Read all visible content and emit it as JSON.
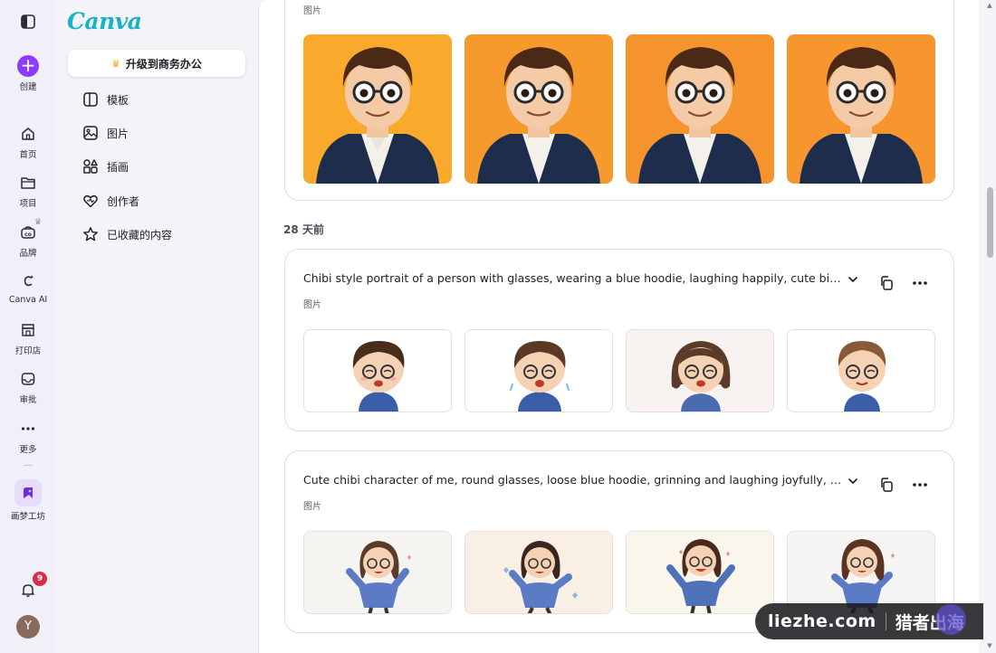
{
  "rail": {
    "create": "创建",
    "home": "首页",
    "projects": "项目",
    "brand": "品牌",
    "canva_ai": "Canva AI",
    "print_shop": "打印店",
    "approvals": "审批",
    "more": "更多",
    "dream_lab": "画梦工坊",
    "notification_count": "9",
    "avatar_initial": "Y"
  },
  "sidebar": {
    "logo": "Canva",
    "upgrade_label": "升级到商务办公",
    "items": [
      {
        "label": "模板",
        "icon": "template-icon"
      },
      {
        "label": "图片",
        "icon": "image-icon"
      },
      {
        "label": "插画",
        "icon": "illustration-icon"
      },
      {
        "label": "创作者",
        "icon": "creator-heart-icon"
      },
      {
        "label": "已收藏的内容",
        "icon": "star-icon"
      }
    ]
  },
  "main": {
    "top_card_subtitle": "图片",
    "section_label": "28 天前",
    "cards": [
      {
        "title": "Chibi style portrait of a person with glasses, wearing a blue hoodie, laughing happily, cute big head, sm...",
        "subtitle": "图片"
      },
      {
        "title": "Cute chibi character of me, round glasses, loose blue hoodie, grinning and laughing joyfully, big shiny e...",
        "subtitle": "图片"
      }
    ]
  },
  "watermark": {
    "domain": "liezhe.com",
    "brand": "猎者出海"
  },
  "colors": {
    "accent": "#8b3dff",
    "logo": "#15b3c6",
    "badge": "#d62d4b"
  }
}
